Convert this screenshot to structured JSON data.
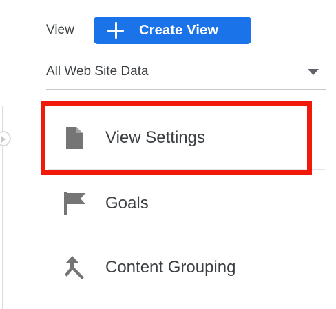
{
  "header": {
    "view_label": "View",
    "create_view_label": "Create View",
    "create_view_icon": "plus-icon"
  },
  "view_select": {
    "selected": "All Web Site Data",
    "caret_icon": "caret-down-icon"
  },
  "menu": {
    "items": [
      {
        "label": "View Settings",
        "icon": "document-icon",
        "highlighted": true
      },
      {
        "label": "Goals",
        "icon": "flag-icon",
        "highlighted": false
      },
      {
        "label": "Content Grouping",
        "icon": "merge-arrows-icon",
        "highlighted": false
      }
    ]
  },
  "colors": {
    "accent": "#1a73e8",
    "highlight": "#f11a0a",
    "icon": "#757575",
    "text": "#3c4043"
  }
}
